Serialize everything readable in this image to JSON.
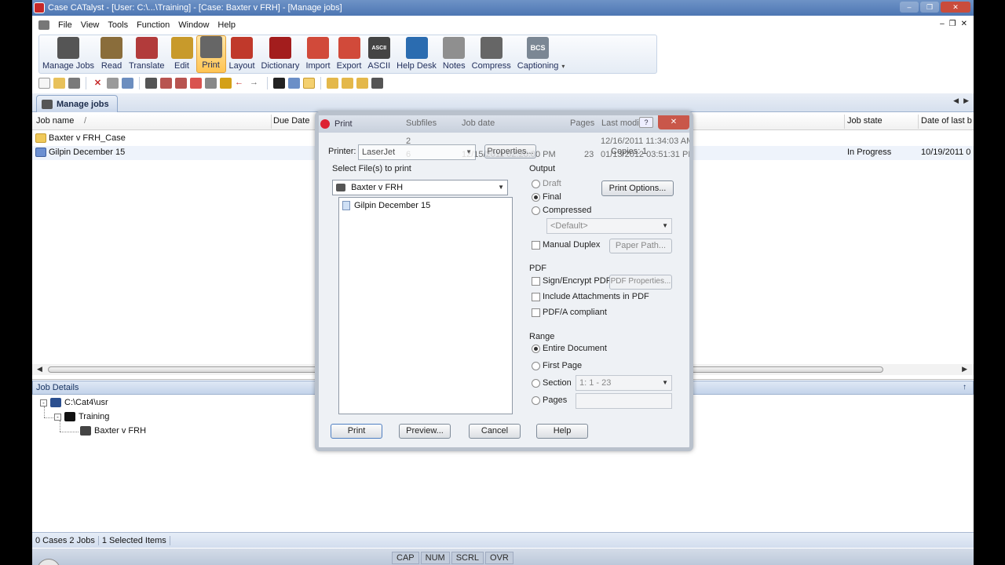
{
  "window": {
    "title": "Case CATalyst - [User: C:\\...\\Training] - [Case: Baxter v FRH] - [Manage jobs]"
  },
  "menu": [
    "File",
    "View",
    "Tools",
    "Function",
    "Window",
    "Help"
  ],
  "ribbon": [
    {
      "label": "Manage Jobs",
      "icon": "manage-jobs-icon",
      "color": "#555555"
    },
    {
      "label": "Read",
      "icon": "read-icon",
      "color": "#8a6d3b"
    },
    {
      "label": "Translate",
      "icon": "translate-icon",
      "color": "#b23b3b"
    },
    {
      "label": "Edit",
      "icon": "edit-icon",
      "color": "#c89a2b"
    },
    {
      "label": "Print",
      "icon": "printer-icon",
      "color": "#666666",
      "active": true
    },
    {
      "label": "Layout",
      "icon": "layout-icon",
      "color": "#c0392b"
    },
    {
      "label": "Dictionary",
      "icon": "dictionary-icon",
      "color": "#a31d1d"
    },
    {
      "label": "Import",
      "icon": "import-icon",
      "color": "#d14a3a"
    },
    {
      "label": "Export",
      "icon": "export-icon",
      "color": "#d14a3a"
    },
    {
      "label": "ASCII",
      "icon": "ascii-icon",
      "color": "#444444"
    },
    {
      "label": "Help Desk",
      "icon": "help-desk-globe-icon",
      "color": "#2b6cb0"
    },
    {
      "label": "Notes",
      "icon": "notes-icon",
      "color": "#8f8f8f"
    },
    {
      "label": "Compress",
      "icon": "compress-icon",
      "color": "#666666"
    },
    {
      "label": "Captioning",
      "icon": "captioning-icon",
      "color": "#7b8794"
    }
  ],
  "ribbon_extra": {
    "bcs": "BCS",
    "ascii_badge": "ASCII"
  },
  "tab": {
    "label": "Manage jobs"
  },
  "list": {
    "columns": [
      "Job name",
      "Due Date",
      "Job state",
      "Date of last b"
    ],
    "sort_indicator": "/",
    "rows": [
      {
        "name": "Baxter v FRH_Case",
        "type": "folder",
        "state": "",
        "date": ""
      },
      {
        "name": "Gilpin December 15",
        "type": "job",
        "state": "In Progress",
        "date": "10/19/2011 0"
      }
    ]
  },
  "details": {
    "title": "Job Details",
    "tree": [
      {
        "label": "C:\\Cat4\\usr",
        "level": 0,
        "toggle": "-"
      },
      {
        "label": "Training",
        "level": 1,
        "toggle": "-"
      },
      {
        "label": "Baxter v FRH",
        "level": 2,
        "toggle": ""
      }
    ]
  },
  "status": {
    "cases": "0 Cases",
    "jobs": "2 Jobs",
    "selected": "1 Selected Items"
  },
  "keys": [
    "CAP",
    "NUM",
    "SCRL",
    "OVR"
  ],
  "dialog": {
    "title": "Print",
    "ghost_headers": {
      "subfiles": "Subfiles",
      "job_date": "Job date",
      "pages": "Pages",
      "last_modified": "Last modified"
    },
    "ghost_values": {
      "row1_sub": "2",
      "row1_mod": "12/16/2011 11:34:03 AM",
      "row2_sub": "6",
      "row2_date": "12/15/2011 02:20:00 PM",
      "row2_pages": "23",
      "row2_mod": "01/13/2012 03:51:31 PM"
    },
    "printer_label": "Printer:",
    "printer_value": "LaserJet",
    "properties_label": "Properties...",
    "copies_label": "Copies:",
    "copies_value": "1",
    "select_files_label": "Select File(s) to print",
    "case_value": "Baxter v FRH",
    "files": [
      "Gilpin December 15"
    ],
    "output_label": "Output",
    "output_options": [
      "Draft",
      "Final",
      "Compressed"
    ],
    "output_selected": "Final",
    "print_options_label": "Print Options...",
    "default_value": "<Default>",
    "manual_duplex_label": "Manual Duplex",
    "paper_path_label": "Paper Path...",
    "pdf_label": "PDF",
    "sign_encrypt_label": "Sign/Encrypt PDF",
    "pdf_properties_label": "PDF Properties...",
    "include_attachments_label": "Include Attachments in PDF",
    "pdfa_label": "PDF/A compliant",
    "range_label": "Range",
    "range_options": [
      "Entire Document",
      "First Page",
      "Section",
      "Pages"
    ],
    "range_selected": "Entire Document",
    "section_value": "1: 1 - 23",
    "buttons": {
      "print": "Print",
      "preview": "Preview...",
      "cancel": "Cancel",
      "help": "Help"
    },
    "help_q": "?"
  }
}
